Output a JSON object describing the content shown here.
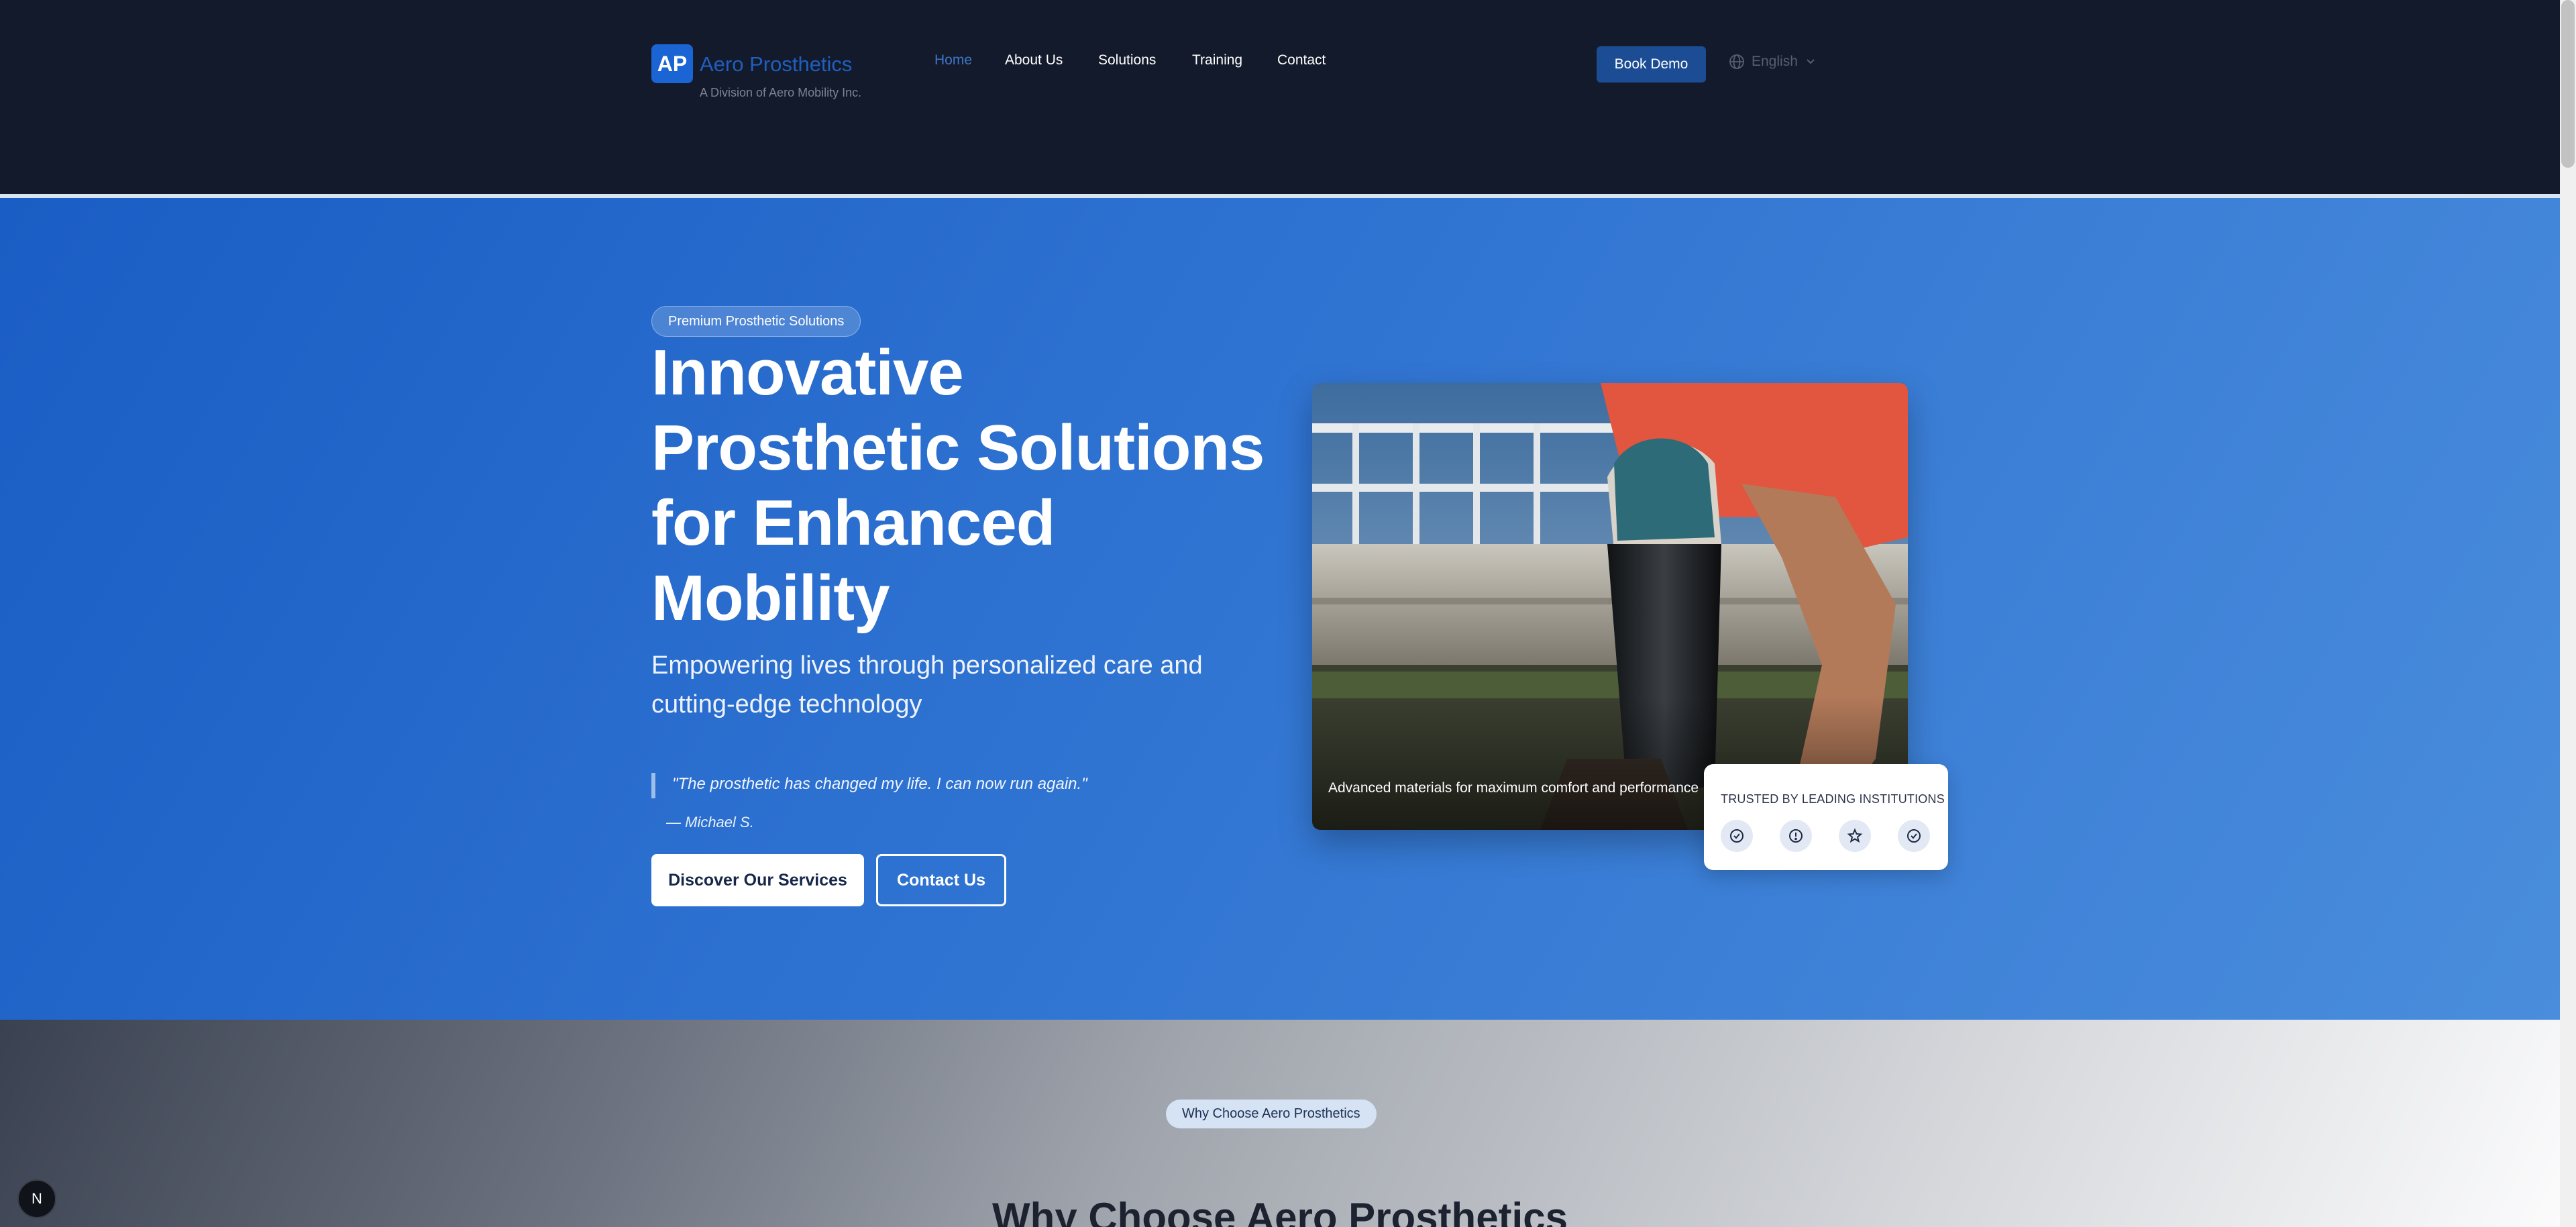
{
  "header": {
    "logo_mark": "AP",
    "brand_name": "Aero Prosthetics",
    "brand_sub": "A Division of Aero Mobility Inc.",
    "nav": [
      {
        "label": "Home"
      },
      {
        "label": "About Us"
      },
      {
        "label": "Solutions"
      },
      {
        "label": "Training"
      },
      {
        "label": "Contact"
      }
    ],
    "book_demo": "Book Demo",
    "language": "English",
    "language_icon": "globe-icon",
    "language_caret": "chevron-down-icon"
  },
  "hero": {
    "badge": "Premium Prosthetic Solutions",
    "title": "Innovative Prosthetic Solutions for Enhanced Mobility",
    "subtitle": "Empowering lives through personalized care and cutting-edge technology",
    "quote": "\"The prosthetic has changed my life. I can now run again.\"",
    "quote_author": "— Michael S.",
    "cta_primary": "Discover Our Services",
    "cta_secondary": "Contact Us",
    "image_caption": "Advanced materials for maximum comfort and performance",
    "trust": {
      "title": "TRUSTED BY LEADING INSTITUTIONS",
      "icons": [
        "check-circle-icon",
        "info-circle-icon",
        "star-icon",
        "check-circle-icon"
      ]
    }
  },
  "why": {
    "badge": "Why Choose Aero Prosthetics",
    "title": "Why Choose Aero Prosthetics"
  },
  "colors": {
    "header_bg": "#131a2b",
    "brand_blue": "#1b64d3",
    "nav_active": "#3f77c9",
    "hero_gradient_start": "#1a5dc4",
    "hero_gradient_end": "#4a8ddc",
    "cta_dark": "#1b4c94"
  },
  "fab_label": "N"
}
